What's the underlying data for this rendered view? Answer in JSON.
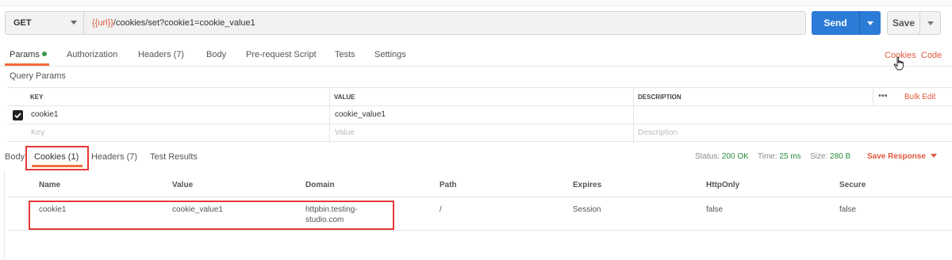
{
  "request": {
    "method": "GET",
    "url_var": "{{url}}",
    "url_path": "/cookies/set?cookie1=cookie_value1",
    "send_label": "Send",
    "save_label": "Save"
  },
  "request_tabs": [
    {
      "label": "Params",
      "active": true
    },
    {
      "label": "Authorization"
    },
    {
      "label": "Headers (7)"
    },
    {
      "label": "Body"
    },
    {
      "label": "Pre-request Script"
    },
    {
      "label": "Tests"
    },
    {
      "label": "Settings"
    }
  ],
  "right_links": {
    "cookies": "Cookies",
    "code": "Code"
  },
  "query_params": {
    "title": "Query Params",
    "headers": {
      "key": "KEY",
      "value": "VALUE",
      "description": "DESCRIPTION",
      "more": "•••",
      "bulk_edit": "Bulk Edit"
    },
    "rows": [
      {
        "checked": true,
        "key": "cookie1",
        "value": "cookie_value1",
        "description": ""
      }
    ],
    "placeholders": {
      "key": "Key",
      "value": "Value",
      "description": "Description"
    }
  },
  "response_tabs": [
    {
      "label": "Body"
    },
    {
      "label": "Cookies (1)",
      "active": true
    },
    {
      "label": "Headers (7)"
    },
    {
      "label": "Test Results"
    }
  ],
  "response_meta": {
    "status_label": "Status:",
    "status": "200 OK",
    "time_label": "Time:",
    "time": "25 ms",
    "size_label": "Size:",
    "size": "280 B",
    "save_response": "Save Response"
  },
  "cookies_table": {
    "columns": [
      "Name",
      "Value",
      "Domain",
      "Path",
      "Expires",
      "HttpOnly",
      "Secure"
    ],
    "rows": [
      {
        "name": "cookie1",
        "value": "cookie_value1",
        "domain_line1": "httpbin.testing-",
        "domain_line2": "studio.com",
        "path": "/",
        "expires": "Session",
        "httponly": "false",
        "secure": "false"
      }
    ]
  },
  "colors": {
    "accent_orange": "#e0593f",
    "send_blue": "#2c7bd6",
    "status_green": "#2b8c3e",
    "highlight_red": "#e53935"
  }
}
